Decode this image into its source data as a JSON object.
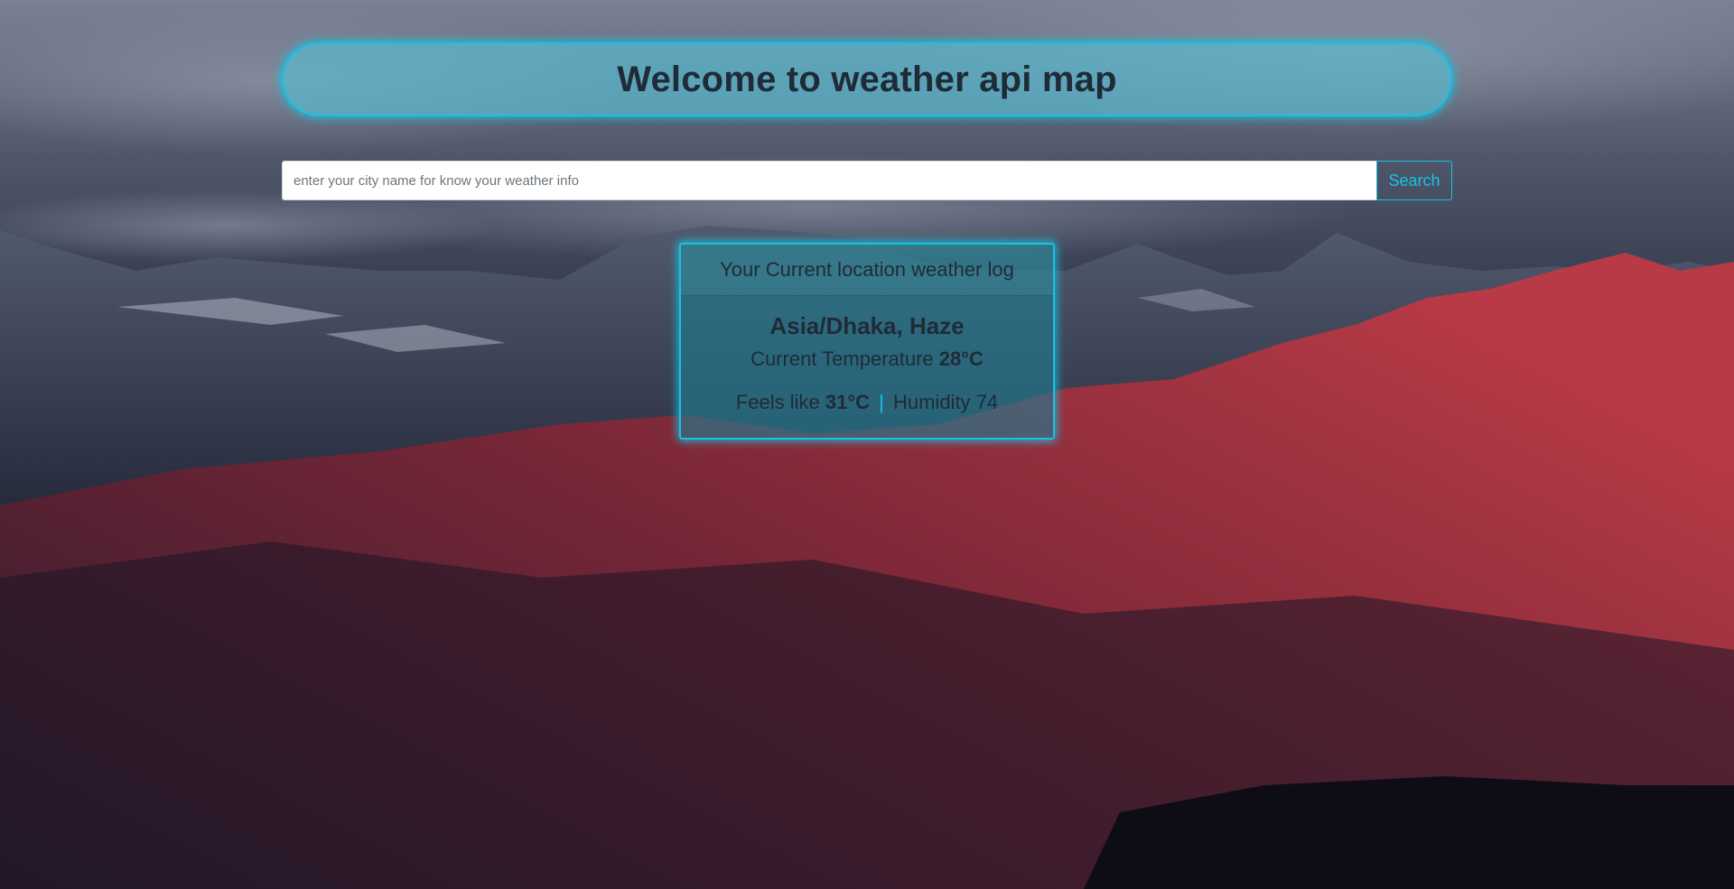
{
  "header": {
    "title": "Welcome to weather api map"
  },
  "search": {
    "placeholder": "enter your city name for know your weather info",
    "value": "",
    "button_label": "Search"
  },
  "weather_card": {
    "title": "Your Current location weather log",
    "location": "Asia/Dhaka, Haze",
    "temp_label": "Current Temperature",
    "temp_value": "28°C",
    "feels_label": "Feels like",
    "feels_value": "31°C",
    "separator": "|",
    "humidity_label": "Humidity",
    "humidity_value": "74"
  },
  "colors": {
    "accent": "#17c3e3",
    "text_dark": "#1f2b36",
    "header_bg": "#5ab9cd",
    "card_bg": "#207d91"
  },
  "background": {
    "description_icon": "mountain-landscape-image"
  }
}
